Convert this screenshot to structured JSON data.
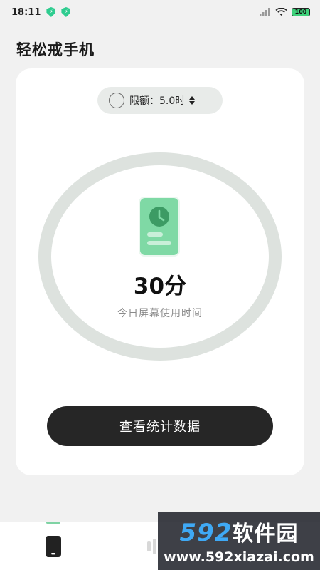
{
  "status_bar": {
    "time": "18:11",
    "battery": "100",
    "icons": [
      "shield-icon",
      "shield-icon",
      "signal-icon",
      "wifi-icon",
      "battery-icon"
    ]
  },
  "app": {
    "title": "轻松戒手机"
  },
  "limit": {
    "label": "限额：5.0时"
  },
  "usage": {
    "value": "30分",
    "caption": "今日屏幕使用时间"
  },
  "actions": {
    "stats_button": "查看统计数据"
  },
  "watermark": {
    "number": "592",
    "brand": "软件园",
    "url": "www.592xiazai.com"
  },
  "colors": {
    "accent_green": "#7fd3a4",
    "ring": "#dde2de",
    "button": "#262626",
    "background": "#f1f1f1"
  }
}
